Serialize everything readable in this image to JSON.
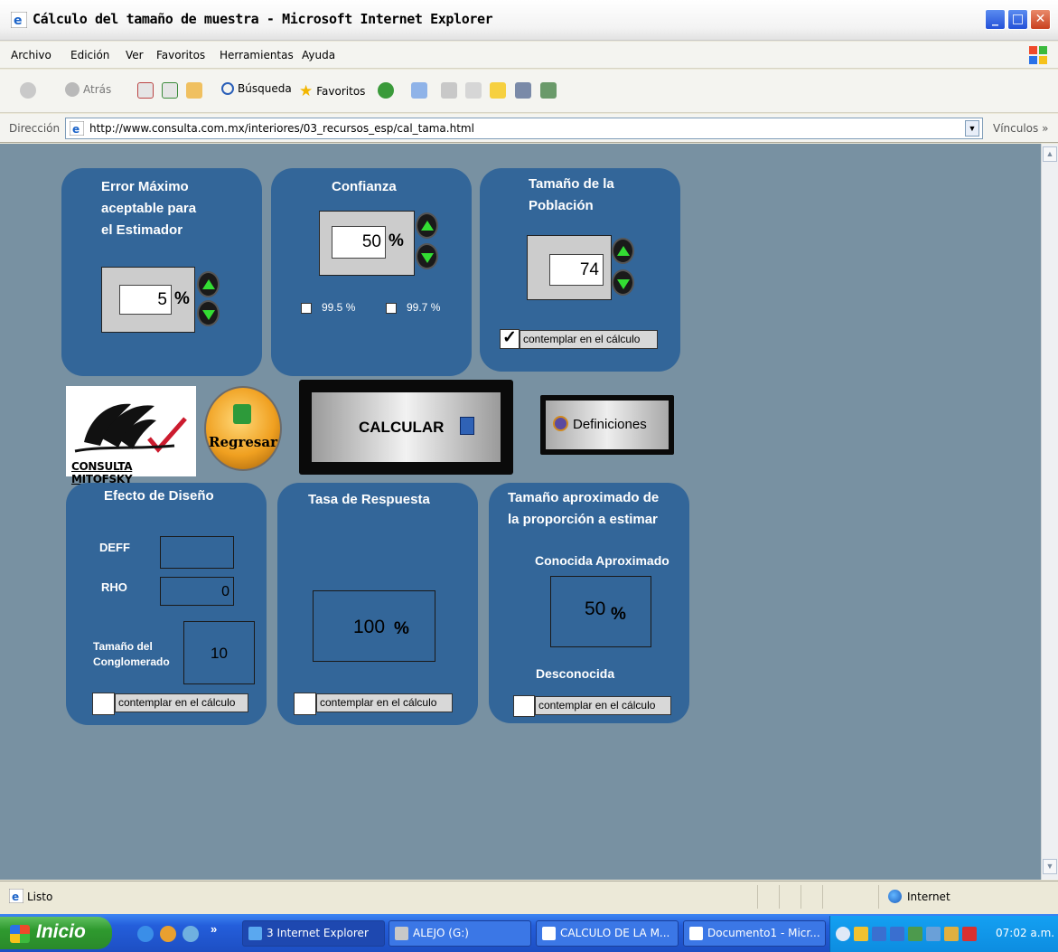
{
  "window": {
    "title": "Cálculo del tamaño de muestra - Microsoft Internet Explorer"
  },
  "menu": [
    "Archivo",
    "Edición",
    "Ver",
    "Favoritos",
    "Herramientas",
    "Ayuda"
  ],
  "toolbar": {
    "back": "Atrás",
    "search": "Búsqueda",
    "favorites": "Favoritos"
  },
  "address": {
    "label": "Dirección",
    "url": "http://www.consulta.com.mx/interiores/03_recursos_esp/cal_tama.html",
    "links": "Vínculos"
  },
  "error_panel": {
    "title_lines": [
      "Error Máximo",
      "aceptable para",
      "el Estimador"
    ],
    "value": "5",
    "unit": "%"
  },
  "confianza_panel": {
    "title": "Confianza",
    "value": "50",
    "unit": "%",
    "options": [
      {
        "label": "99.5 %",
        "checked": false
      },
      {
        "label": "99.7 %",
        "checked": false
      }
    ]
  },
  "poblacion_panel": {
    "title_lines": [
      "Tamaño de la",
      "Población"
    ],
    "value": "74",
    "contemplar_label": "contemplar en el cálculo",
    "contemplar_checked": true
  },
  "actions": {
    "logo_text": "CONSULTA MITOFSKY",
    "regresar": "Regresar",
    "calcular": "CALCULAR",
    "definiciones": "Definiciones"
  },
  "diseno_panel": {
    "title": "Efecto de Diseño",
    "deff_label": "DEFF",
    "deff_value": "",
    "rho_label": "RHO",
    "rho_value": "0",
    "cluster_label_lines": [
      "Tamaño del",
      "Conglomerado"
    ],
    "cluster_value": "10",
    "contemplar_label": "contemplar en el cálculo",
    "contemplar_checked": false
  },
  "respuesta_panel": {
    "title": "Tasa de Respuesta",
    "value": "100",
    "unit": "%",
    "contemplar_label": "contemplar en el cálculo",
    "contemplar_checked": false
  },
  "proporcion_panel": {
    "title_lines": [
      "Tamaño aproximado de",
      "la proporción a estimar"
    ],
    "known_label": "Conocida Aproximado",
    "value": "50",
    "unit": "%",
    "unknown_label": "Desconocida",
    "contemplar_label": "contemplar en el cálculo",
    "contemplar_checked": false
  },
  "status": {
    "text": "Listo",
    "zone": "Internet"
  },
  "taskbar": {
    "start": "Inicio",
    "tasks": [
      {
        "label": "3 Internet Explorer",
        "active": true
      },
      {
        "label": "ALEJO (G:)",
        "active": false
      },
      {
        "label": "CALCULO DE LA M...",
        "active": false
      },
      {
        "label": "Documento1 - Micr...",
        "active": false
      }
    ],
    "clock": "07:02 a.m."
  }
}
